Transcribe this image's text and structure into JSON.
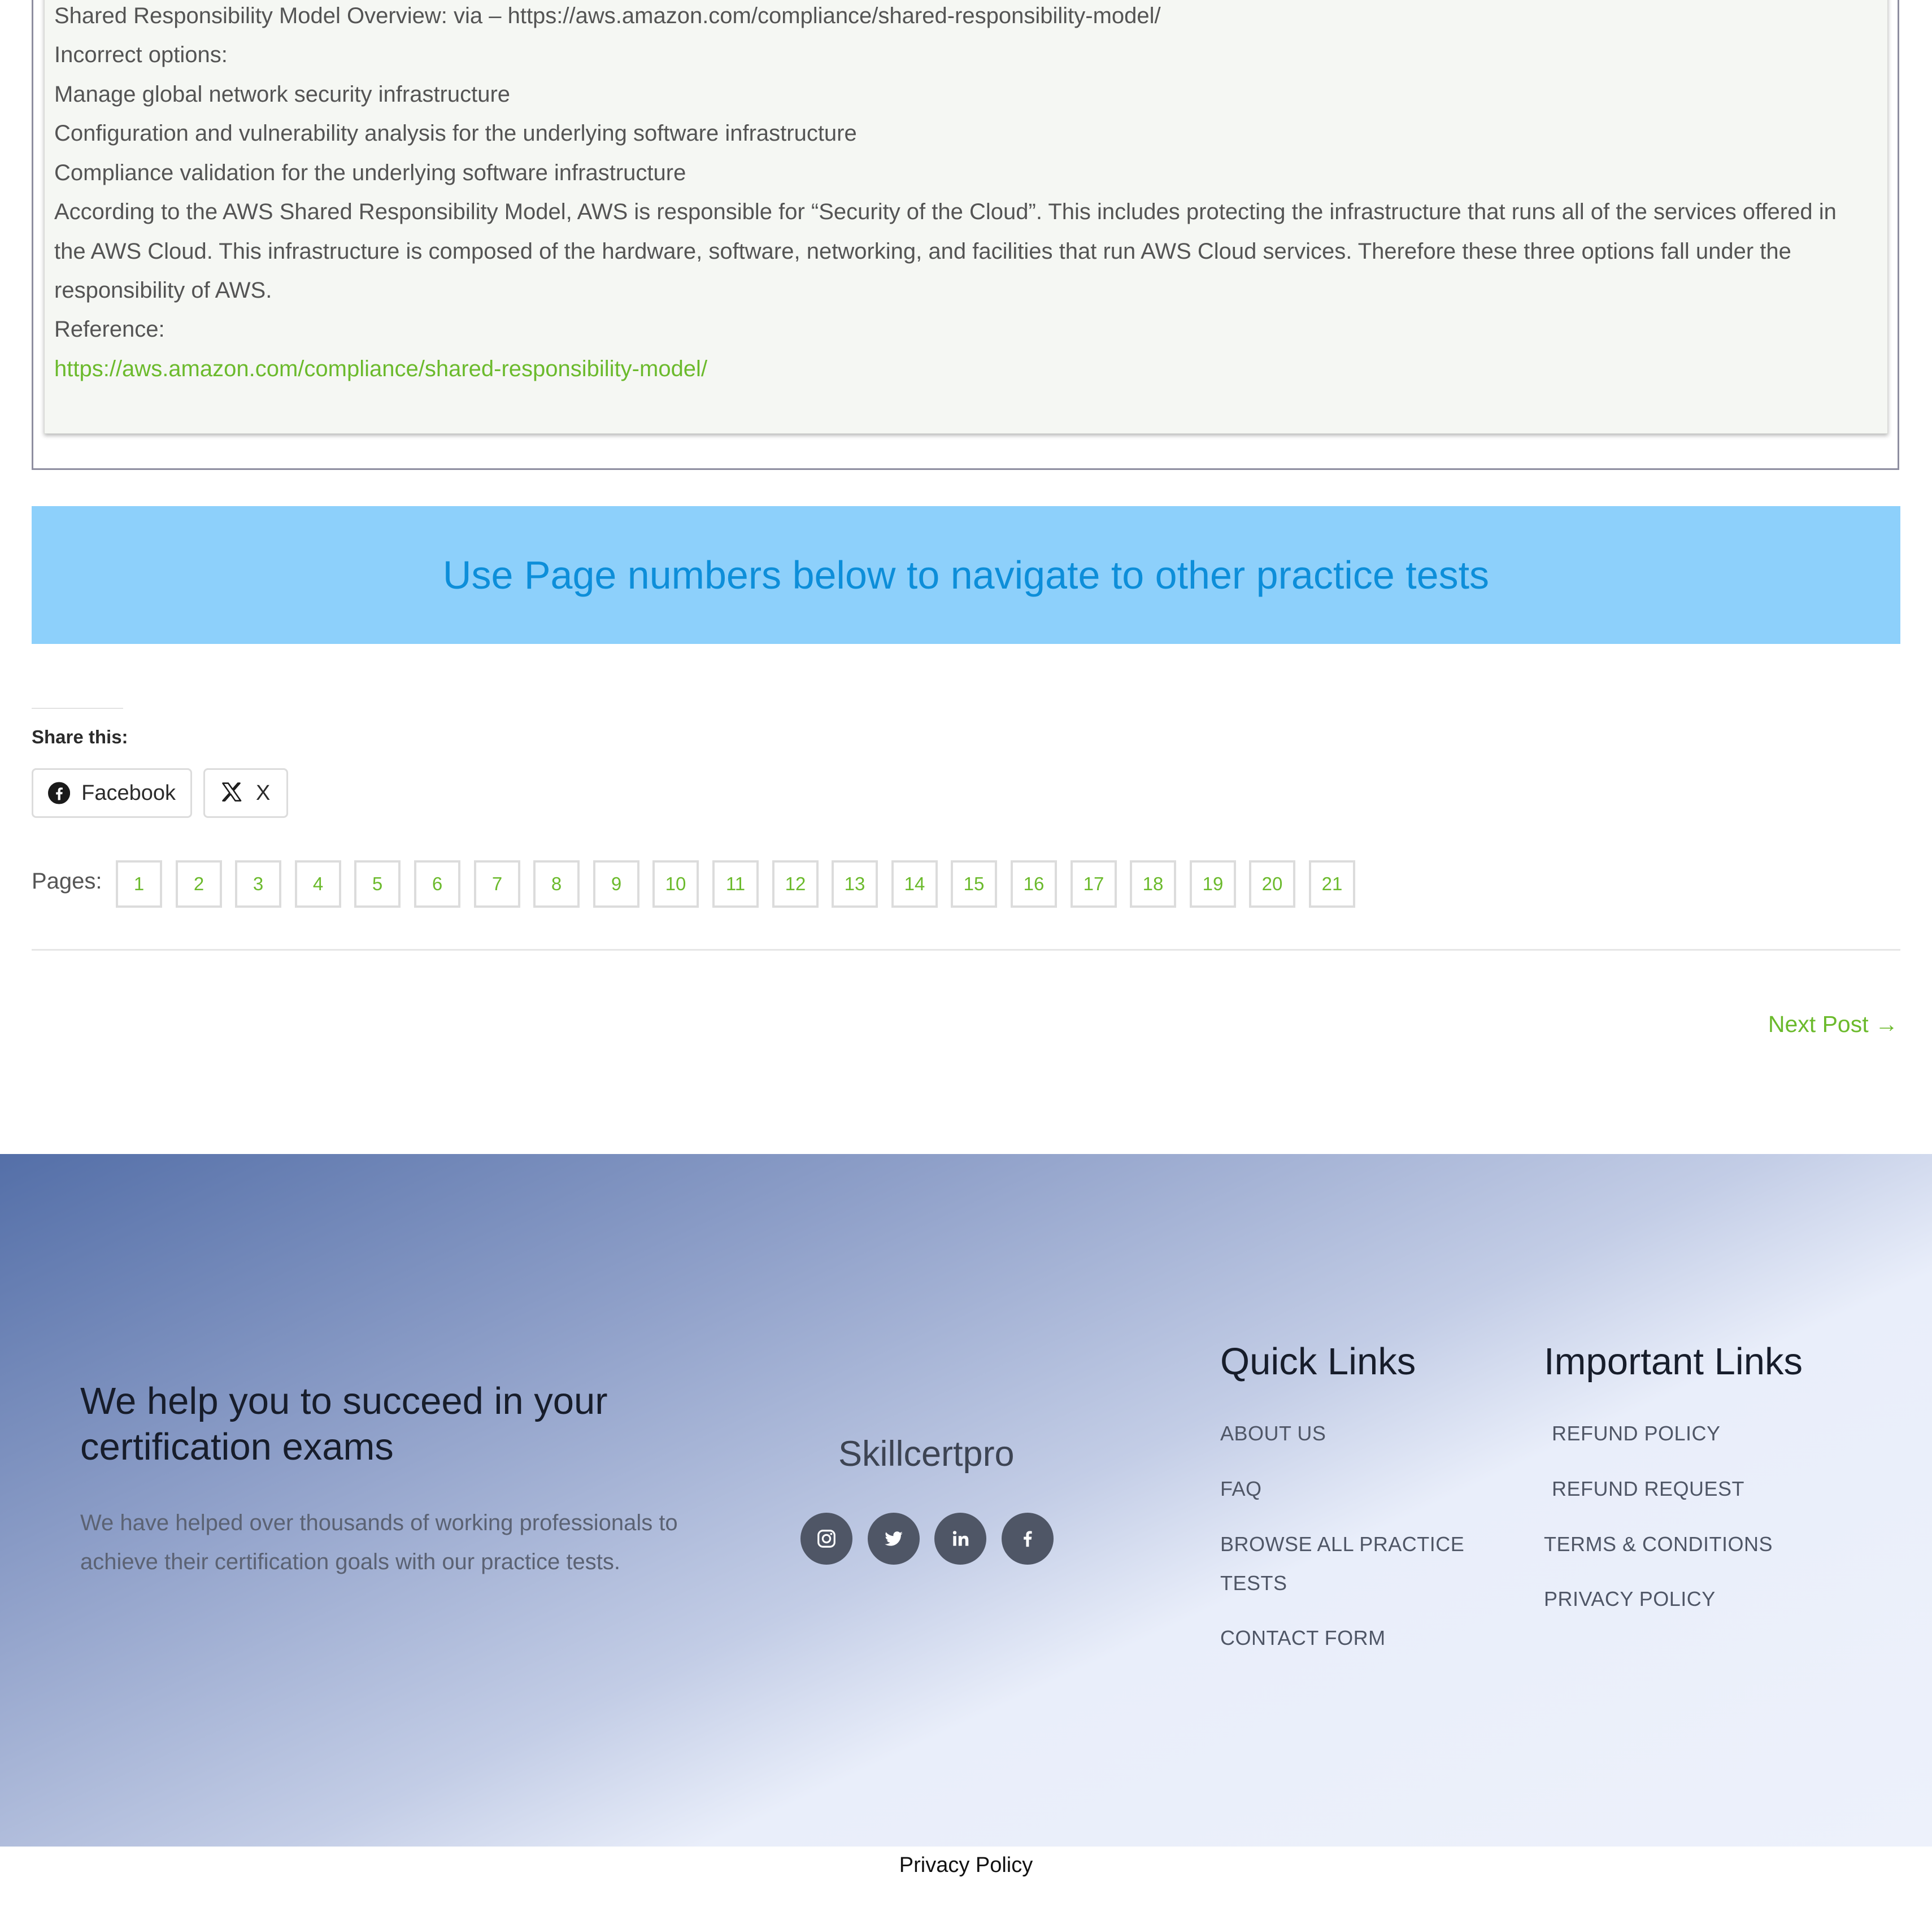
{
  "explanation": {
    "lines": [
      "Shared Responsibility Model Overview:  via – https://aws.amazon.com/compliance/shared-responsibility-model/",
      "Incorrect options:",
      "Manage global network security infrastructure",
      "Configuration and vulnerability analysis for the underlying software infrastructure",
      "Compliance validation for the underlying software infrastructure",
      "According to the AWS Shared Responsibility Model, AWS is responsible for “Security of the Cloud”. This includes protecting the infrastructure that runs all of the services offered in the AWS Cloud. This infrastructure is composed of the hardware, software, networking, and facilities that run AWS Cloud services. Therefore these three options fall under the responsibility of AWS.",
      "Reference:"
    ],
    "reference_link": "https://aws.amazon.com/compliance/shared-responsibility-model/"
  },
  "banner": {
    "text": "Use Page numbers below to navigate to other practice tests"
  },
  "share": {
    "heading": "Share this:",
    "facebook_label": "Facebook",
    "x_label": "X"
  },
  "pagination": {
    "label": "Pages:",
    "pages": [
      "1",
      "2",
      "3",
      "4",
      "5",
      "6",
      "7",
      "8",
      "9",
      "10",
      "11",
      "12",
      "13",
      "14",
      "15",
      "16",
      "17",
      "18",
      "19",
      "20",
      "21"
    ]
  },
  "next_post": {
    "label": "Next Post →"
  },
  "footer": {
    "heading": "We help you to succeed in your certification exams",
    "paragraph": "We have helped over thousands of working professionals to achieve their certification goals with our practice tests.",
    "brand": "Skillcertpro",
    "social_icons": [
      "instagram-icon",
      "twitter-icon",
      "linkedin-icon",
      "facebook-icon"
    ],
    "quick_links": {
      "title": "Quick Links",
      "items": [
        "ABOUT US",
        "FAQ",
        "BROWSE ALL PRACTICE TESTS",
        "CONTACT FORM"
      ]
    },
    "important_links": {
      "title": "Important Links",
      "items": [
        "REFUND POLICY",
        "REFUND REQUEST",
        "TERMS & CONDITIONS",
        "PRIVACY POLICY"
      ]
    }
  },
  "bottom_bar": {
    "text": "Privacy Policy"
  },
  "colors": {
    "accent_green": "#6bba2c",
    "banner_bg": "#8dd0fb",
    "banner_text": "#0d8ed9",
    "social_bg": "#4f5666"
  }
}
